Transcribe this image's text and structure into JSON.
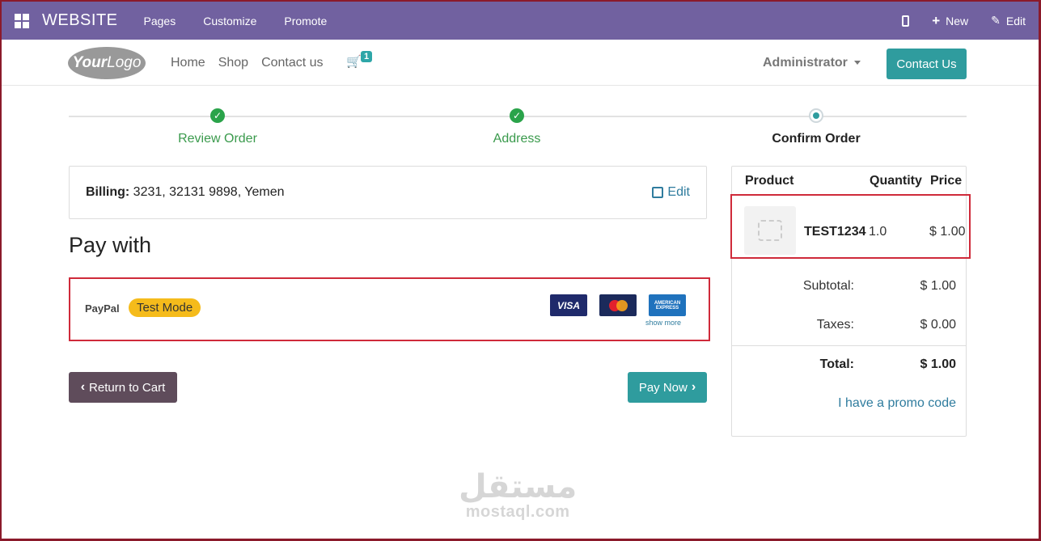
{
  "admin_bar": {
    "brand": "WEBSITE",
    "menu": [
      "Pages",
      "Customize",
      "Promote"
    ],
    "new_label": "New",
    "edit_label": "Edit"
  },
  "site_nav": {
    "logo_text_bold": "Your",
    "logo_text": "Logo",
    "links": [
      "Home",
      "Shop",
      "Contact us"
    ],
    "cart_count": "1",
    "user": "Administrator",
    "contact_button": "Contact Us"
  },
  "steps": [
    {
      "label": "Review Order",
      "state": "done"
    },
    {
      "label": "Address",
      "state": "done"
    },
    {
      "label": "Confirm Order",
      "state": "current"
    }
  ],
  "billing": {
    "label": "Billing:",
    "value": "3231, 32131 9898, Yemen",
    "edit": "Edit"
  },
  "pay_with": "Pay with",
  "payment": {
    "provider": "PayPal",
    "mode_badge": "Test Mode",
    "cards": [
      "VISA",
      "MasterCard",
      "AMERICAN EXPRESS"
    ],
    "show_more": "show more"
  },
  "buttons": {
    "return": "Return to Cart",
    "pay": "Pay Now"
  },
  "summary": {
    "headers": {
      "product": "Product",
      "quantity": "Quantity",
      "price": "Price"
    },
    "product": {
      "name": "TEST1234",
      "qty": "1.0",
      "price": "$ 1.00"
    },
    "subtotal_label": "Subtotal:",
    "subtotal": "$ 1.00",
    "taxes_label": "Taxes:",
    "taxes": "$ 0.00",
    "total_label": "Total:",
    "total": "$ 1.00",
    "promo": "I have a promo code"
  },
  "watermark": {
    "arabic": "مستقل",
    "latin": "mostaql.com"
  },
  "colors": {
    "admin_bar": "#7161a0",
    "primary": "#2f9c9e",
    "success": "#2aa34a",
    "highlight": "#cf2a3a",
    "badge": "#f5bb1b"
  }
}
